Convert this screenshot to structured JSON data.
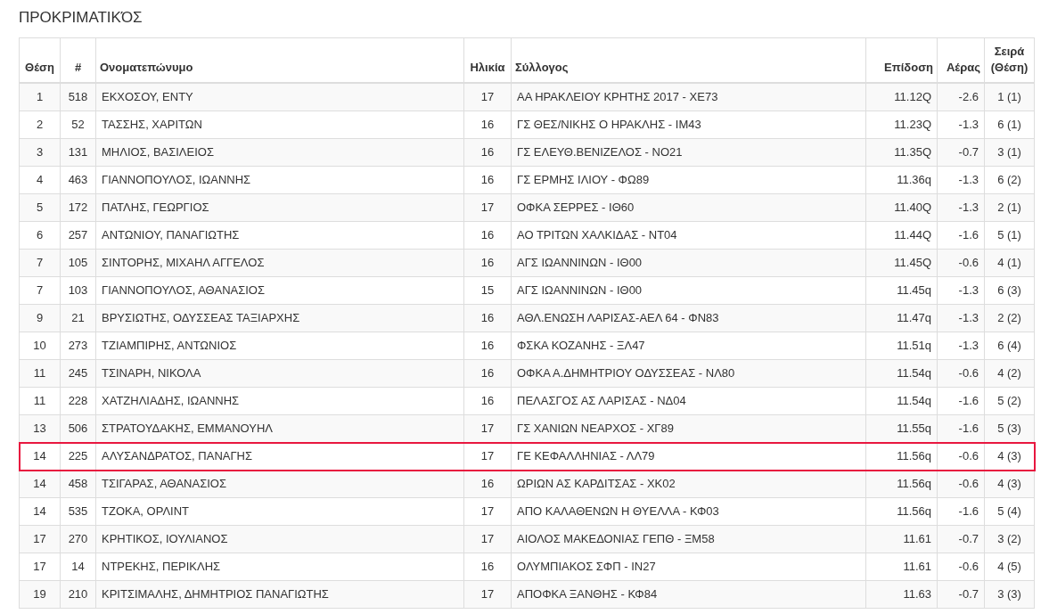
{
  "title": "ΠΡΟΚΡΙΜΑΤΙΚΌΣ",
  "table": {
    "columns": [
      "Θέση",
      "#",
      "Ονοματεπώνυμο",
      "Ηλικία",
      "Σύλλογος",
      "Επίδοση",
      "Αέρας",
      "Σειρά (Θέση)"
    ],
    "rows": [
      {
        "selected": false,
        "cells": [
          "1",
          "518",
          "ΕΚΧΟΣΟΥ, ΕΝΤΥ",
          "17",
          "ΑΑ ΗΡΑΚΛΕΙΟΥ ΚΡΗΤΗΣ 2017 - ΧΕ73",
          "11.12Q",
          "-2.6",
          "1 (1)"
        ]
      },
      {
        "selected": false,
        "cells": [
          "2",
          "52",
          "ΤΑΣΣΗΣ, ΧΑΡΙΤΩΝ",
          "16",
          "ΓΣ ΘΕΣ/ΝΙΚΗΣ Ο ΗΡΑΚΛΗΣ - ΙΜ43",
          "11.23Q",
          "-1.3",
          "6 (1)"
        ]
      },
      {
        "selected": false,
        "cells": [
          "3",
          "131",
          "ΜΗΛΙΟΣ, ΒΑΣΙΛΕΙΟΣ",
          "16",
          "ΓΣ ΕΛΕΥΘ.ΒΕΝΙΖΕΛΟΣ - ΝΟ21",
          "11.35Q",
          "-0.7",
          "3 (1)"
        ]
      },
      {
        "selected": false,
        "cells": [
          "4",
          "463",
          "ΓΙΑΝΝΟΠΟΥΛΟΣ, ΙΩΑΝΝΗΣ",
          "16",
          "ΓΣ ΕΡΜΗΣ ΙΛΙΟΥ - ΦΩ89",
          "11.36q",
          "-1.3",
          "6 (2)"
        ]
      },
      {
        "selected": false,
        "cells": [
          "5",
          "172",
          "ΠΑΤΛΗΣ, ΓΕΩΡΓΙΟΣ",
          "17",
          "ΟΦΚΑ ΣΕΡΡΕΣ - ΙΘ60",
          "11.40Q",
          "-1.3",
          "2 (1)"
        ]
      },
      {
        "selected": false,
        "cells": [
          "6",
          "257",
          "ΑΝΤΩΝΙΟΥ, ΠΑΝΑΓΙΩΤΗΣ",
          "16",
          "ΑΟ ΤΡΙΤΩΝ ΧΑΛΚΙΔΑΣ - ΝΤ04",
          "11.44Q",
          "-1.6",
          "5 (1)"
        ]
      },
      {
        "selected": false,
        "cells": [
          "7",
          "105",
          "ΣΙΝΤΟΡΗΣ, ΜΙΧΑΗΛ ΑΓΓΕΛΟΣ",
          "16",
          "ΑΓΣ ΙΩΑΝΝΙΝΩΝ - ΙΘ00",
          "11.45Q",
          "-0.6",
          "4 (1)"
        ]
      },
      {
        "selected": false,
        "cells": [
          "7",
          "103",
          "ΓΙΑΝΝΟΠΟΥΛΟΣ, ΑΘΑΝΑΣΙΟΣ",
          "15",
          "ΑΓΣ ΙΩΑΝΝΙΝΩΝ - ΙΘ00",
          "11.45q",
          "-1.3",
          "6 (3)"
        ]
      },
      {
        "selected": false,
        "cells": [
          "9",
          "21",
          "ΒΡΥΣΙΩΤΗΣ, ΟΔΥΣΣΕΑΣ ΤΑΞΙΑΡΧΗΣ",
          "16",
          "ΑΘΛ.ΕΝΩΣΗ ΛΑΡΙΣΑΣ-ΑΕΛ 64 - ΦΝ83",
          "11.47q",
          "-1.3",
          "2 (2)"
        ]
      },
      {
        "selected": false,
        "cells": [
          "10",
          "273",
          "ΤΖΙΑΜΠΙΡΗΣ, ΑΝΤΩΝΙΟΣ",
          "16",
          "ΦΣΚΑ ΚΟΖΑΝΗΣ - ΞΛ47",
          "11.51q",
          "-1.3",
          "6 (4)"
        ]
      },
      {
        "selected": false,
        "cells": [
          "11",
          "245",
          "ΤΣΙΝΑΡΗ, ΝΙΚΟΛΑ",
          "16",
          "ΟΦΚΑ Α.ΔΗΜΗΤΡΙΟΥ ΟΔΥΣΣΕΑΣ - ΝΛ80",
          "11.54q",
          "-0.6",
          "4 (2)"
        ]
      },
      {
        "selected": false,
        "cells": [
          "11",
          "228",
          "ΧΑΤΖΗΛΙΑΔΗΣ, ΙΩΑΝΝΗΣ",
          "16",
          "ΠΕΛΑΣΓΟΣ ΑΣ ΛΑΡΙΣΑΣ - ΝΔ04",
          "11.54q",
          "-1.6",
          "5 (2)"
        ]
      },
      {
        "selected": false,
        "cells": [
          "13",
          "506",
          "ΣΤΡΑΤΟΥΔΑΚΗΣ, ΕΜΜΑΝΟΥΗΛ",
          "17",
          "ΓΣ ΧΑΝΙΩΝ ΝΕΑΡΧΟΣ - ΧΓ89",
          "11.55q",
          "-1.6",
          "5 (3)"
        ]
      },
      {
        "selected": true,
        "cells": [
          "14",
          "225",
          "ΑΛΥΣΑΝΔΡΑΤΟΣ, ΠΑΝΑΓΗΣ",
          "17",
          "ΓΕ ΚΕΦΑΛΛΗΝΙΑΣ - ΛΛ79",
          "11.56q",
          "-0.6",
          "4 (3)"
        ]
      },
      {
        "selected": false,
        "cells": [
          "14",
          "458",
          "ΤΣΙΓΑΡΑΣ, ΑΘΑΝΑΣΙΟΣ",
          "16",
          "ΩΡΙΩΝ ΑΣ ΚΑΡΔΙΤΣΑΣ - ΧΚ02",
          "11.56q",
          "-0.6",
          "4 (3)"
        ]
      },
      {
        "selected": false,
        "cells": [
          "14",
          "535",
          "ΤΖΟΚΑ, ΟΡΛΙΝΤ",
          "17",
          "ΑΠΟ ΚΑΛΑΘΕΝΩΝ Η ΘΥΕΛΛΑ - ΚΦ03",
          "11.56q",
          "-1.6",
          "5 (4)"
        ]
      },
      {
        "selected": false,
        "cells": [
          "17",
          "270",
          "ΚΡΗΤΙΚΟΣ, ΙΟΥΛΙΑΝΟΣ",
          "17",
          "ΑΙΟΛΟΣ ΜΑΚΕΔΟΝΙΑΣ ΓΕΠΘ - ΞΜ58",
          "11.61",
          "-0.7",
          "3 (2)"
        ]
      },
      {
        "selected": false,
        "cells": [
          "17",
          "14",
          "ΝΤΡΕΚΗΣ, ΠΕΡΙΚΛΗΣ",
          "16",
          "ΟΛΥΜΠΙΑΚΟΣ ΣΦΠ - ΙΝ27",
          "11.61",
          "-0.6",
          "4 (5)"
        ]
      },
      {
        "selected": false,
        "cells": [
          "19",
          "210",
          "ΚΡΙΤΣΙΜΑΛΗΣ, ΔΗΜΗΤΡΙΟΣ ΠΑΝΑΓΙΩΤΗΣ",
          "17",
          "ΑΠΟΦΚΑ ΞΑΝΘΗΣ - ΚΦ84",
          "11.63",
          "-0.7",
          "3 (3)"
        ]
      }
    ]
  }
}
